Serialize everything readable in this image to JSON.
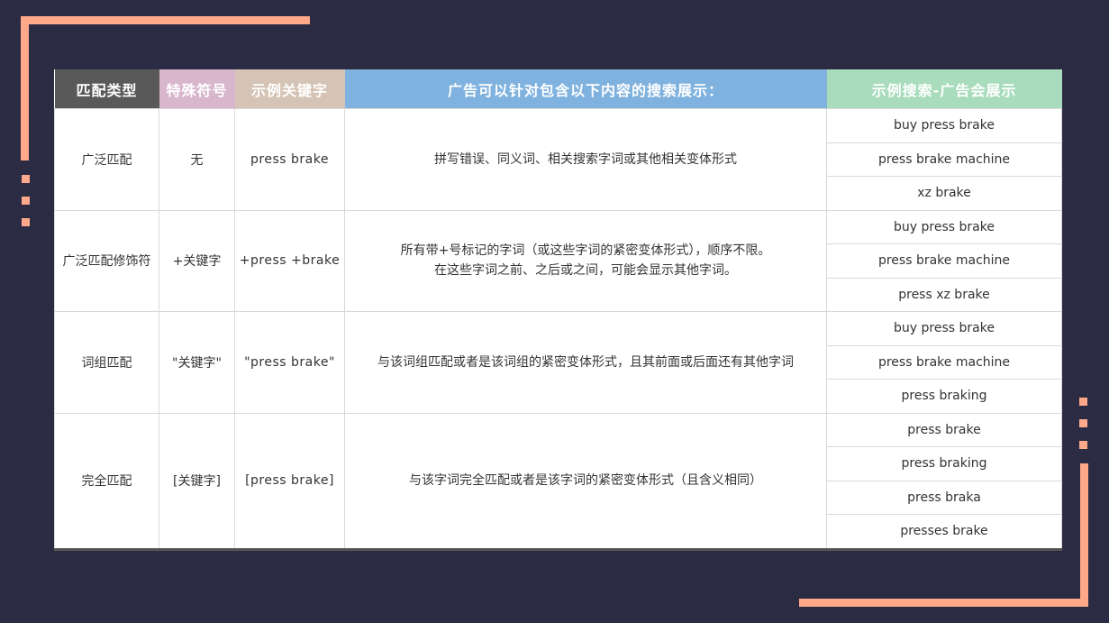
{
  "headers": [
    "匹配类型",
    "特殊符号",
    "示例关键字",
    "广告可以针对包含以下内容的搜索展示：",
    "示例搜索-广告会展示"
  ],
  "rows": [
    {
      "type": "广泛匹配",
      "symbol": "无",
      "keyword": "press brake",
      "description": [
        "拼写错误、同义词、相关搜索字词或其他相关变体形式"
      ],
      "examples": [
        "buy press brake",
        "press brake machine",
        "xz brake"
      ]
    },
    {
      "type": "广泛匹配修饰符",
      "symbol": "+关键字",
      "keyword": "+press +brake",
      "description": [
        "所有带+号标记的字词（或这些字词的紧密变体形式），顺序不限。",
        "在这些字词之前、之后或之间，可能会显示其他字词。"
      ],
      "examples": [
        "buy press brake",
        "press brake machine",
        "press xz brake"
      ]
    },
    {
      "type": "词组匹配",
      "symbol": "\"关键字\"",
      "keyword": "\"press brake\"",
      "description": [
        "与该词组匹配或者是该词组的紧密变体形式，且其前面或后面还有其他字词"
      ],
      "examples": [
        "buy press brake",
        "press brake machine",
        "press braking"
      ]
    },
    {
      "type": "完全匹配",
      "symbol": "[关键字]",
      "keyword": "[press brake]",
      "description": [
        "与该字词完全匹配或者是该字词的紧密变体形式（且含义相同）"
      ],
      "examples": [
        "press brake",
        "press braking",
        "press braka",
        "presses brake"
      ]
    }
  ],
  "colors": {
    "background": "#2b2b43",
    "accent": "#ffa98a",
    "header_type": "#595959",
    "header_symbol": "#d8b6cc",
    "header_keyword": "#d5c4b5",
    "header_description": "#7fb2de",
    "header_examples": "#a9dcbc"
  }
}
